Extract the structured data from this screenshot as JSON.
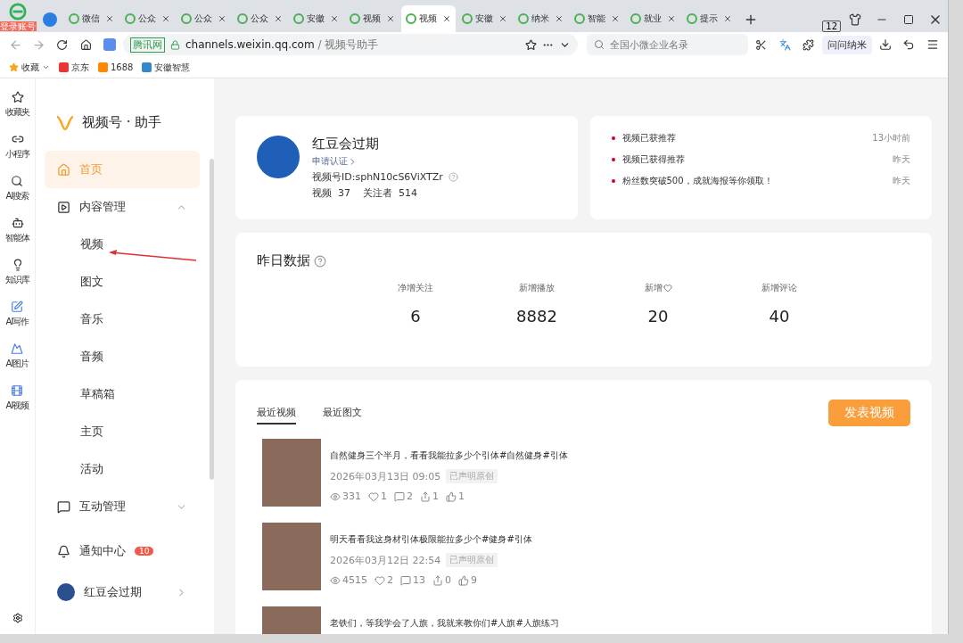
{
  "browser": {
    "login_badge": "登录账号",
    "tabs": [
      {
        "label": "微信",
        "selected": false
      },
      {
        "label": "公众",
        "selected": false
      },
      {
        "label": "公众",
        "selected": false
      },
      {
        "label": "公众",
        "selected": false
      },
      {
        "label": "安徽",
        "selected": false
      },
      {
        "label": "视频",
        "selected": false
      },
      {
        "label": "视频",
        "selected": true
      },
      {
        "label": "安徽",
        "selected": false
      },
      {
        "label": "纳米",
        "selected": false
      },
      {
        "label": "智能",
        "selected": false
      },
      {
        "label": "就业",
        "selected": false
      },
      {
        "label": "提示",
        "selected": false
      }
    ],
    "tab_count": "12",
    "address": {
      "site": "腾讯网",
      "url": "channels.weixin.qq.com",
      "path": "/ 视频号助手"
    },
    "search": {
      "placeholder": "全国小微企业名录"
    },
    "assistant": "问问纳米",
    "bookmarks": [
      {
        "label": "收藏"
      },
      {
        "label": "京东"
      },
      {
        "label": "1688"
      },
      {
        "label": "安徽智慧"
      }
    ]
  },
  "rail": [
    {
      "label": "收藏夹"
    },
    {
      "label": "小程序"
    },
    {
      "label": "AI搜索"
    },
    {
      "label": "智能体"
    },
    {
      "label": "知识库"
    },
    {
      "label": "AI写作"
    },
    {
      "label": "AI图片"
    },
    {
      "label": "AI视频"
    }
  ],
  "sidebar": {
    "brand": "视频号 · 助手",
    "items": [
      {
        "label": "首页",
        "selected": true
      },
      {
        "label": "内容管理",
        "selected": false,
        "expanded": true,
        "children": [
          {
            "label": "视频",
            "selected": false
          },
          {
            "label": "图文",
            "selected": false
          },
          {
            "label": "音乐",
            "selected": false
          },
          {
            "label": "音频",
            "selected": false
          },
          {
            "label": "草稿箱",
            "selected": false
          },
          {
            "label": "主页",
            "selected": false
          },
          {
            "label": "活动",
            "selected": false
          }
        ]
      },
      {
        "label": "互动管理",
        "selected": false,
        "expanded": false
      }
    ],
    "notifications": {
      "label": "通知中心",
      "badge": "10"
    },
    "user": "红豆会过期"
  },
  "profile": {
    "name": "红豆会过期",
    "verify": "申请认证",
    "id": "视频号ID:sphN10cS6ViXTZr",
    "stats": [
      {
        "label": "视频",
        "value": "37"
      },
      {
        "label": "关注者",
        "value": "514"
      }
    ]
  },
  "notices": [
    {
      "text": "视频已获推荐",
      "time": "13小时前"
    },
    {
      "text": "视频已获得推荐",
      "time": "昨天"
    },
    {
      "text": "粉丝数突破500，成就海报等你领取！",
      "time": "昨天"
    }
  ],
  "yesterday": {
    "title": "昨日数据",
    "metrics": [
      {
        "label": "净增关注",
        "value": "6",
        "heart": false
      },
      {
        "label": "新增播放",
        "value": "8882",
        "heart": false
      },
      {
        "label": "新增",
        "value": "20",
        "heart": true
      },
      {
        "label": "新增评论",
        "value": "40",
        "heart": false
      }
    ]
  },
  "recent": {
    "tabs": [
      {
        "label": "最近视频",
        "selected": true
      },
      {
        "label": "最近图文",
        "selected": false
      }
    ],
    "publish": "发表视频",
    "videos": [
      {
        "title": "自然健身三个半月，看看我能拉多少个引体#自然健身#引体",
        "date": "2026年03月13日 09:05",
        "badge": "已声明原创",
        "stats": [
          "331",
          "1",
          "2",
          "1",
          "1"
        ]
      },
      {
        "title": "明天看看我这身材引体极限能拉多少个#健身#引体",
        "date": "2026年03月12日 22:54",
        "badge": "已声明原创",
        "stats": [
          "4515",
          "2",
          "13",
          "0",
          "9"
        ]
      },
      {
        "title": "老铁们，等我学会了人旗，我就来教你们#人旗#人旗练习"
      }
    ]
  }
}
